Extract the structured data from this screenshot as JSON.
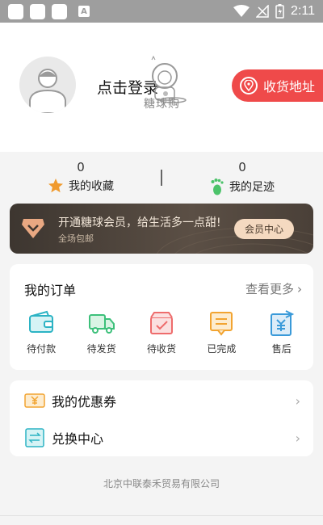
{
  "status_bar": {
    "time": "2:11",
    "notif_letter": "A"
  },
  "header": {
    "login_text": "点击登录",
    "logo_text": "糖球购",
    "address_button": "收货地址"
  },
  "stats": {
    "favorites": {
      "count": "0",
      "label": "我的收藏"
    },
    "footprints": {
      "count": "0",
      "label": "我的足迹"
    }
  },
  "vip": {
    "title": "开通糖球会员，给生活多一点甜!",
    "subtitle": "全场包邮",
    "button": "会员中心"
  },
  "orders": {
    "title": "我的订单",
    "more": "查看更多",
    "items": [
      {
        "label": "待付款",
        "icon": "wallet-icon",
        "color": "#2cb3c4"
      },
      {
        "label": "待发货",
        "icon": "truck-icon",
        "color": "#3cc07a"
      },
      {
        "label": "待收货",
        "icon": "box-icon",
        "color": "#ee6c6c"
      },
      {
        "label": "已完成",
        "icon": "document-icon",
        "color": "#f2a431"
      },
      {
        "label": "售后",
        "icon": "refund-icon",
        "color": "#3a9ad9"
      }
    ]
  },
  "menu": {
    "coupons": {
      "label": "我的优惠券",
      "icon": "coupon-icon"
    },
    "exchange": {
      "label": "兑换中心",
      "icon": "exchange-icon"
    }
  },
  "footer": {
    "company": "北京中联泰禾贸易有限公司"
  },
  "colors": {
    "accent_red": "#ef4a4a",
    "star": "#f09a2e",
    "foot": "#4cc36a"
  }
}
